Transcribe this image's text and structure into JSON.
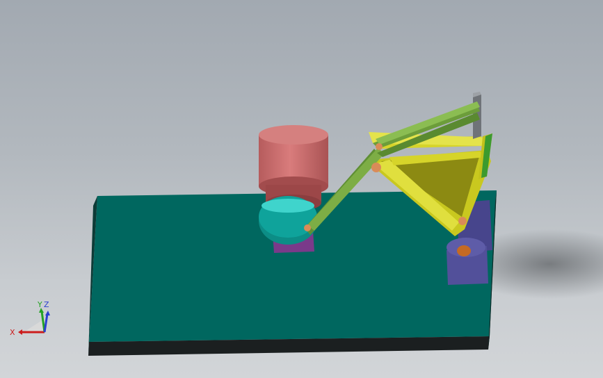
{
  "viewport": {
    "background_top": "#a2a9b1",
    "background_bottom": "#d2d5d8"
  },
  "model": {
    "parts": [
      {
        "name": "base-plate",
        "color": "#00675f"
      },
      {
        "name": "motor-housing",
        "color": "#c8696a"
      },
      {
        "name": "crank-disc",
        "color": "#0fa39b"
      },
      {
        "name": "motor-mount",
        "color": "#7a3a8a"
      },
      {
        "name": "coupler-links",
        "color": "#6c9d3a"
      },
      {
        "name": "yellow-rocker-frame",
        "color": "#d6d42a"
      },
      {
        "name": "pivot-supports",
        "color": "#52509a"
      },
      {
        "name": "pin-joints",
        "color": "#d98b58"
      },
      {
        "name": "end-plate",
        "color": "#6f7378"
      }
    ]
  },
  "triad": {
    "x_label": "X",
    "y_label": "Y",
    "z_label": "Z",
    "x_color": "#cc1c1c",
    "y_color": "#24a324",
    "z_color": "#2a3fcf"
  }
}
